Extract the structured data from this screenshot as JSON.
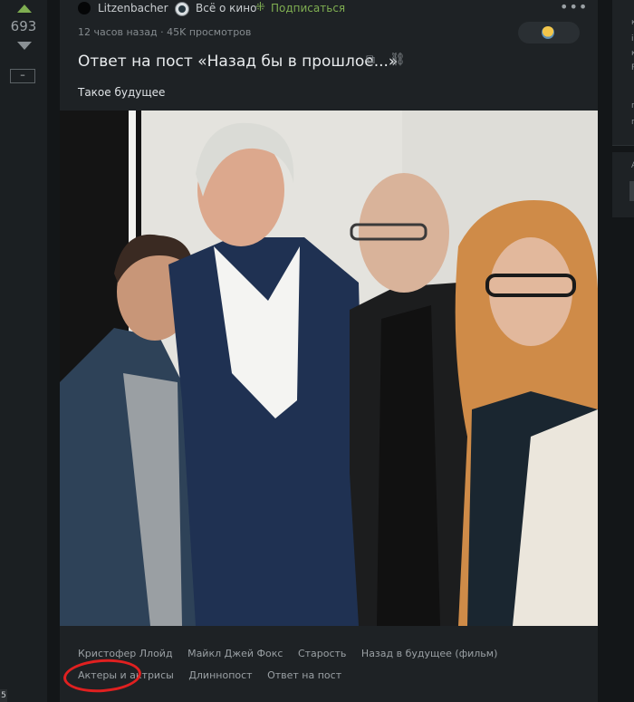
{
  "rating": {
    "value": "693",
    "collapse_label": "–",
    "corner_number": "5"
  },
  "post": {
    "author": "Litzenbacher",
    "community": "Всё о кино",
    "subscribe_label": "Подписаться",
    "meta": "12 часов назад · 45K просмотров",
    "title": "Ответ на пост «Назад бы в прошлое...»",
    "text": "Такое будущее",
    "tags": [
      "Кристофер Ллойд",
      "Майкл Джей Фокс",
      "Старость",
      "Назад в будущее (фильм)",
      "Актеры и актрисы",
      "Длиннопост",
      "Ответ на пост"
    ],
    "highlighted_tag": "Длиннопост"
  },
  "colors": {
    "accent_green": "#7fae51",
    "background": "#131618",
    "card": "#1e2225",
    "highlight_red": "#e02020"
  },
  "icons": {
    "subscribe": "subscribe-icon",
    "more": "more-icon",
    "share": "share-icon",
    "link": "link-icon",
    "reaction": "reaction-icon"
  },
  "sidebar": {
    "fragment_letters": [
      "к",
      "і",
      "к",
      "Р",
      "п",
      "п",
      "А"
    ]
  }
}
